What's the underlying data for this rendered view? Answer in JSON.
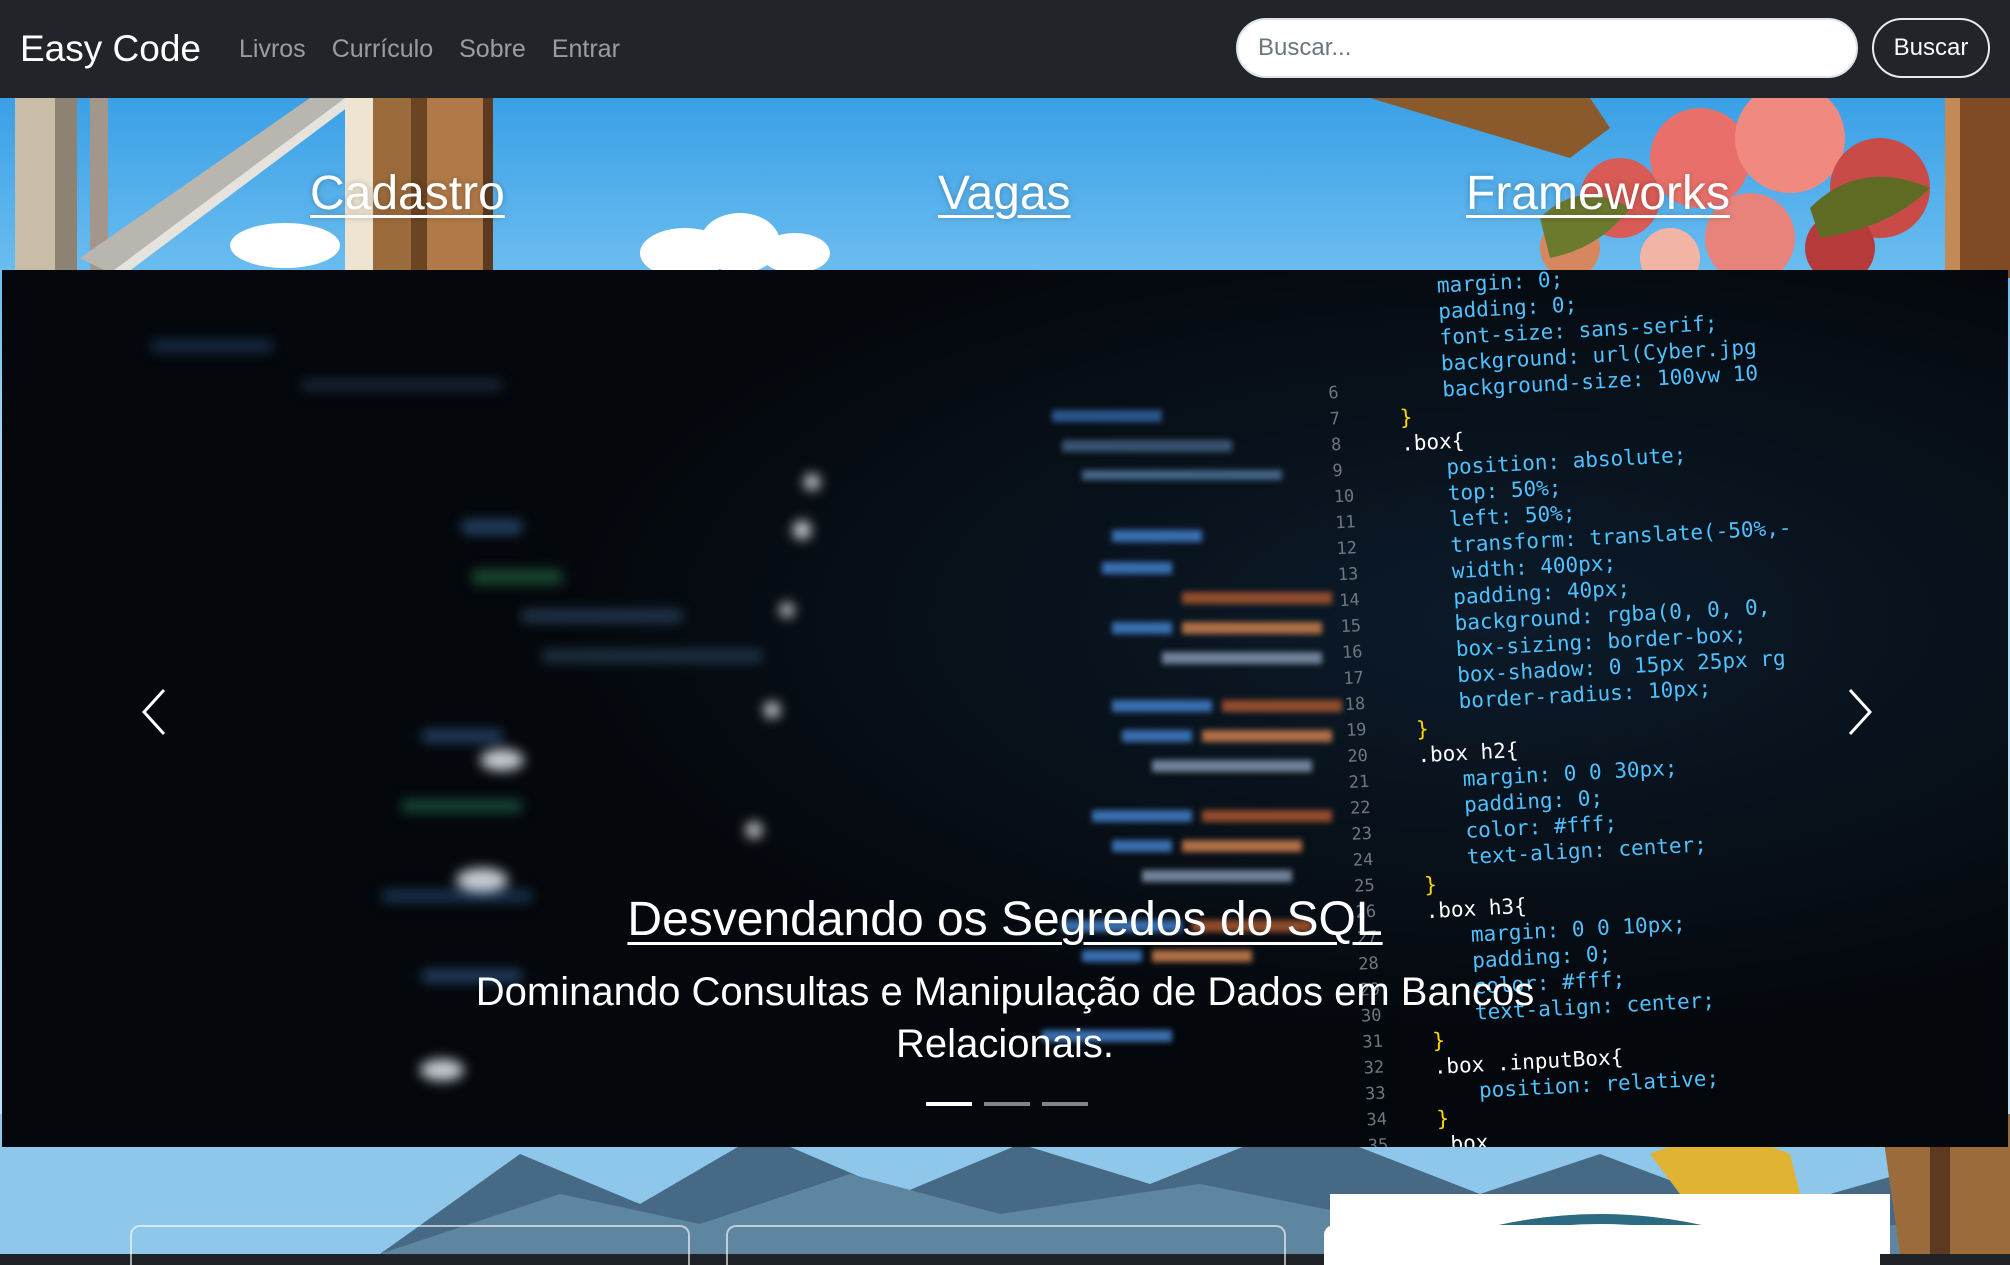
{
  "navbar": {
    "brand": "Easy Code",
    "links": [
      "Livros",
      "Currículo",
      "Sobre",
      "Entrar"
    ],
    "search_placeholder": "Buscar...",
    "search_button": "Buscar"
  },
  "top_links": [
    "Cadastro",
    "Vagas",
    "Frameworks"
  ],
  "carousel": {
    "title": "Desvendando os Segredos do SQL",
    "text": "Dominando Consultas e Manipulação de Dados em Bancos Relacionais.",
    "slides_count": 3,
    "active_slide": 1,
    "code": [
      "margin: 0;",
      "padding: 0;",
      "font-size: sans-serif;",
      "background: url(Cyber.jpg",
      "background-size: 100vw 10",
      "}",
      ".box{",
      "position: absolute;",
      "top: 50%;",
      "left: 50%;",
      "transform: translate(-50%,-",
      "width: 400px;",
      "padding: 40px;",
      "background: rgba(0, 0, 0,",
      "box-sizing: border-box;",
      "box-shadow: 0 15px 25px rg",
      "border-radius: 10px;",
      "}",
      ".box h2{",
      "margin: 0 0 30px;",
      "padding: 0;",
      "color: #fff;",
      "text-align: center;",
      "}",
      ".box h3{",
      "margin: 0 0 10px;",
      "padding: 0;",
      "color: #fff;",
      "text-align: center;",
      "}",
      ".box .inputBox{",
      "position: relative;",
      "}",
      ".box"
    ],
    "line_numbers": [
      "6",
      "7",
      "8",
      "9",
      "10",
      "11",
      "12",
      "13",
      "14",
      "15",
      "16",
      "17",
      "18",
      "19",
      "20",
      "21",
      "22",
      "23",
      "24",
      "25",
      "26",
      "27",
      "28",
      "29",
      "30",
      "31",
      "32",
      "33",
      "34",
      "35"
    ]
  },
  "colors": {
    "navbar_bg": "#212529",
    "code_property": "#4fc1ff",
    "code_value": "#e6db74",
    "code_selector": "#ffffff",
    "code_brace": "#ffd700"
  }
}
